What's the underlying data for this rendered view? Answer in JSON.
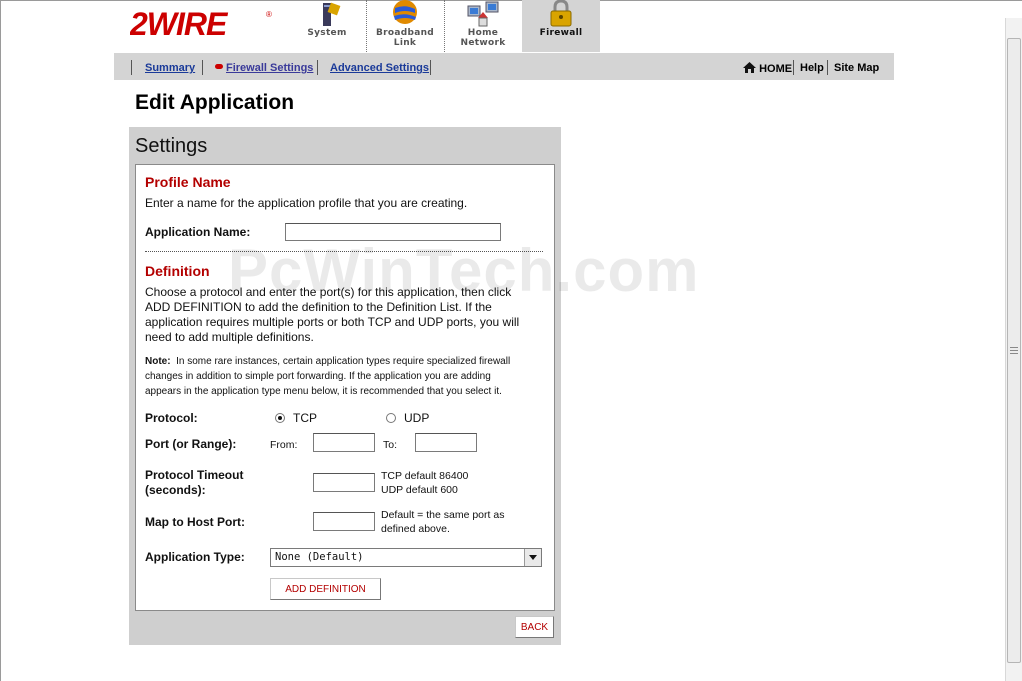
{
  "brand": {
    "logo_text": "2WIRE"
  },
  "nav_tabs": [
    {
      "label": "System",
      "icon": "system-icon"
    },
    {
      "label": "Broadband\nLink",
      "icon": "globe-icon"
    },
    {
      "label": "Home\nNetwork",
      "icon": "home-network-icon"
    },
    {
      "label": "Firewall",
      "icon": "padlock-icon",
      "active": true
    }
  ],
  "subnav": {
    "links": [
      "Summary",
      "Firewall Settings",
      "Advanced Settings"
    ],
    "current": "Firewall Settings",
    "right_links": [
      "HOME",
      "Help",
      "Site Map"
    ]
  },
  "page_title": "Edit Application",
  "settings": {
    "title": "Settings",
    "profile": {
      "title": "Profile Name",
      "desc": "Enter a name for the application profile that you are creating.",
      "app_name_label": "Application Name:",
      "app_name_value": ""
    },
    "definition": {
      "title": "Definition",
      "desc_lines": [
        "Choose a protocol and enter the port(s) for this application, then click",
        "ADD DEFINITION to add the definition to the Definition List. If the",
        "application requires multiple ports or both TCP and UDP ports, you will",
        "need to add multiple definitions."
      ],
      "note_label": "Note:",
      "note_lines": [
        "In some rare instances, certain application types require specialized firewall",
        "changes in addition to simple port forwarding. If the application you are adding",
        "appears in the application type menu below, it is recommended that you select it."
      ],
      "protocol_label": "Protocol:",
      "protocol_options": [
        "TCP",
        "UDP"
      ],
      "protocol_selected": "TCP",
      "port_label": "Port (or Range):",
      "from_label": "From:",
      "to_label": "To:",
      "from_value": "",
      "to_value": "",
      "timeout_label_lines": [
        "Protocol Timeout",
        "(seconds):"
      ],
      "timeout_value": "",
      "timeout_hint_lines": [
        "TCP default 86400",
        "UDP default 600"
      ],
      "map_label": "Map to Host Port:",
      "map_value": "",
      "map_hint_lines": [
        "Default = the same port as",
        "defined above."
      ],
      "app_type_label": "Application Type:",
      "app_type_selected": "None (Default)",
      "add_button": "ADD DEFINITION"
    },
    "back_button": "BACK"
  },
  "watermark": "PcWinTech.com",
  "colors": {
    "section_red": "#b30000",
    "link_blue": "#1a3a99",
    "panel_gray": "#cfcfcf"
  }
}
